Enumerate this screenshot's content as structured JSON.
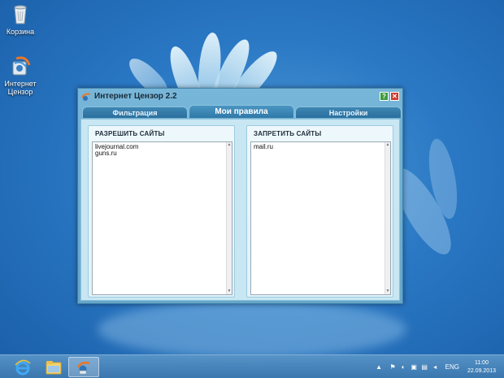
{
  "desktop": {
    "icons": [
      {
        "label": "Корзина",
        "icon": "recycle-bin-icon"
      },
      {
        "label": "Интернет Цензор",
        "icon": "internet-censor-icon"
      }
    ]
  },
  "window": {
    "title": "Интернет Цензор 2.2",
    "tabs": [
      {
        "label": "Фильтрация"
      },
      {
        "label": "Мои правила"
      },
      {
        "label": "Настройки"
      }
    ],
    "allow": {
      "title": "РАЗРЕШИТЬ САЙТЫ",
      "items": [
        "livejournal.com",
        "guns.ru"
      ]
    },
    "deny": {
      "title": "ЗАПРЕТИТЬ САЙТЫ",
      "items": [
        "mail.ru"
      ]
    }
  },
  "taskbar": {
    "language": "ENG",
    "time": "11:00",
    "date": "22.09.2013"
  },
  "colors": {
    "accent": "#2a6f9e",
    "close": "#cf3a2e",
    "help": "#3c9a3c"
  }
}
